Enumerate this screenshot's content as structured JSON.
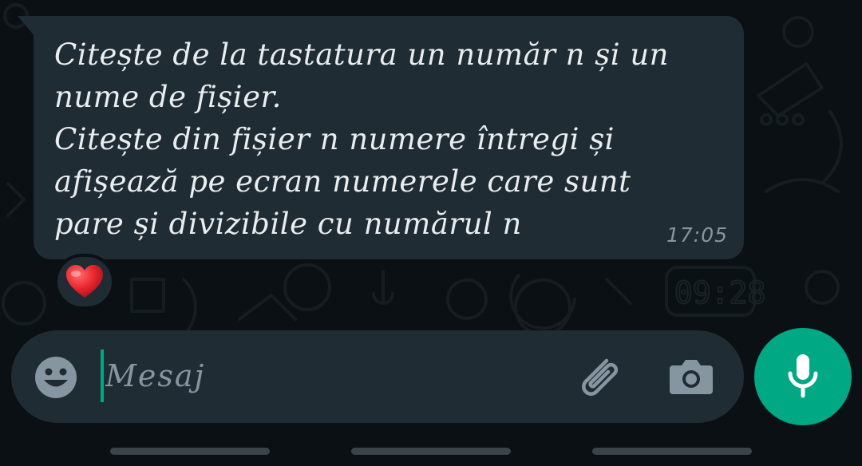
{
  "message": {
    "text": "Citește de la tastatura un număr n și un\nnume de fișier.\nCitește din fișier n numere întregi și\nafișează pe ecran numerele care sunt\npare și divizibile cu numărul n",
    "time": "17:05",
    "reaction": {
      "emoji": "❤️",
      "icon": "heart-icon",
      "color": "#e8262f"
    }
  },
  "composer": {
    "placeholder": "Mesaj",
    "emoji_icon": "emoji-face-icon",
    "attach_icon": "paperclip-icon",
    "camera_icon": "camera-icon",
    "mic_icon": "microphone-icon"
  },
  "colors": {
    "background": "#0b1014",
    "bubble": "#1f2c33",
    "text": "#e9edef",
    "muted": "#8696a0",
    "accent": "#00a884"
  }
}
